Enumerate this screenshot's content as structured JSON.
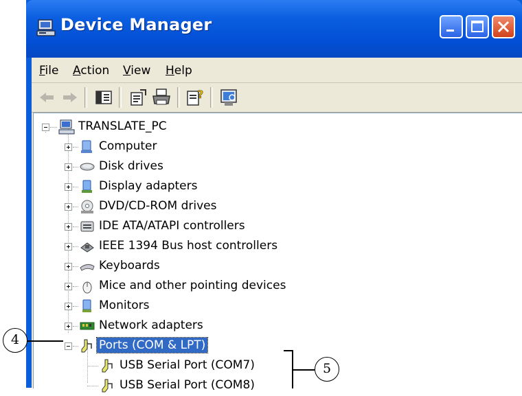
{
  "window": {
    "title": "Device Manager",
    "icon": "device-manager-icon",
    "controls": [
      "minimize-icon",
      "maximize-icon",
      "close-icon"
    ]
  },
  "menubar": {
    "items": [
      {
        "label": "File",
        "accel": "F"
      },
      {
        "label": "Action",
        "accel": "A"
      },
      {
        "label": "View",
        "accel": "V"
      },
      {
        "label": "Help",
        "accel": "H"
      }
    ]
  },
  "toolbar": {
    "buttons": [
      "back-arrow-icon",
      "forward-arrow-icon",
      "show-hide-tree-icon",
      "properties-icon",
      "print-icon",
      "help-icon",
      "scan-hardware-icon"
    ]
  },
  "tree": {
    "root": "TRANSLATE_PC",
    "categories": [
      {
        "label": "Computer",
        "icon": "computer-icon"
      },
      {
        "label": "Disk drives",
        "icon": "disk-drive-icon"
      },
      {
        "label": "Display adapters",
        "icon": "display-adapter-icon"
      },
      {
        "label": "DVD/CD-ROM drives",
        "icon": "cdrom-icon"
      },
      {
        "label": "IDE ATA/ATAPI controllers",
        "icon": "ide-controller-icon"
      },
      {
        "label": "IEEE 1394 Bus host controllers",
        "icon": "firewire-icon"
      },
      {
        "label": "Keyboards",
        "icon": "keyboard-icon"
      },
      {
        "label": "Mice and other pointing devices",
        "icon": "mouse-icon"
      },
      {
        "label": "Monitors",
        "icon": "monitor-icon"
      },
      {
        "label": "Network adapters",
        "icon": "network-adapter-icon"
      },
      {
        "label": "Ports (COM & LPT)",
        "icon": "port-icon",
        "expanded": true,
        "selected": true
      }
    ],
    "port_children": [
      {
        "label": "USB Serial Port (COM7)",
        "icon": "port-icon"
      },
      {
        "label": "USB Serial Port (COM8)",
        "icon": "port-icon"
      }
    ]
  },
  "callouts": {
    "left": "4",
    "right": "5"
  },
  "colors": {
    "titlebar": "#0350d6",
    "selection": "#316ac5",
    "chrome": "#ece9d8"
  }
}
